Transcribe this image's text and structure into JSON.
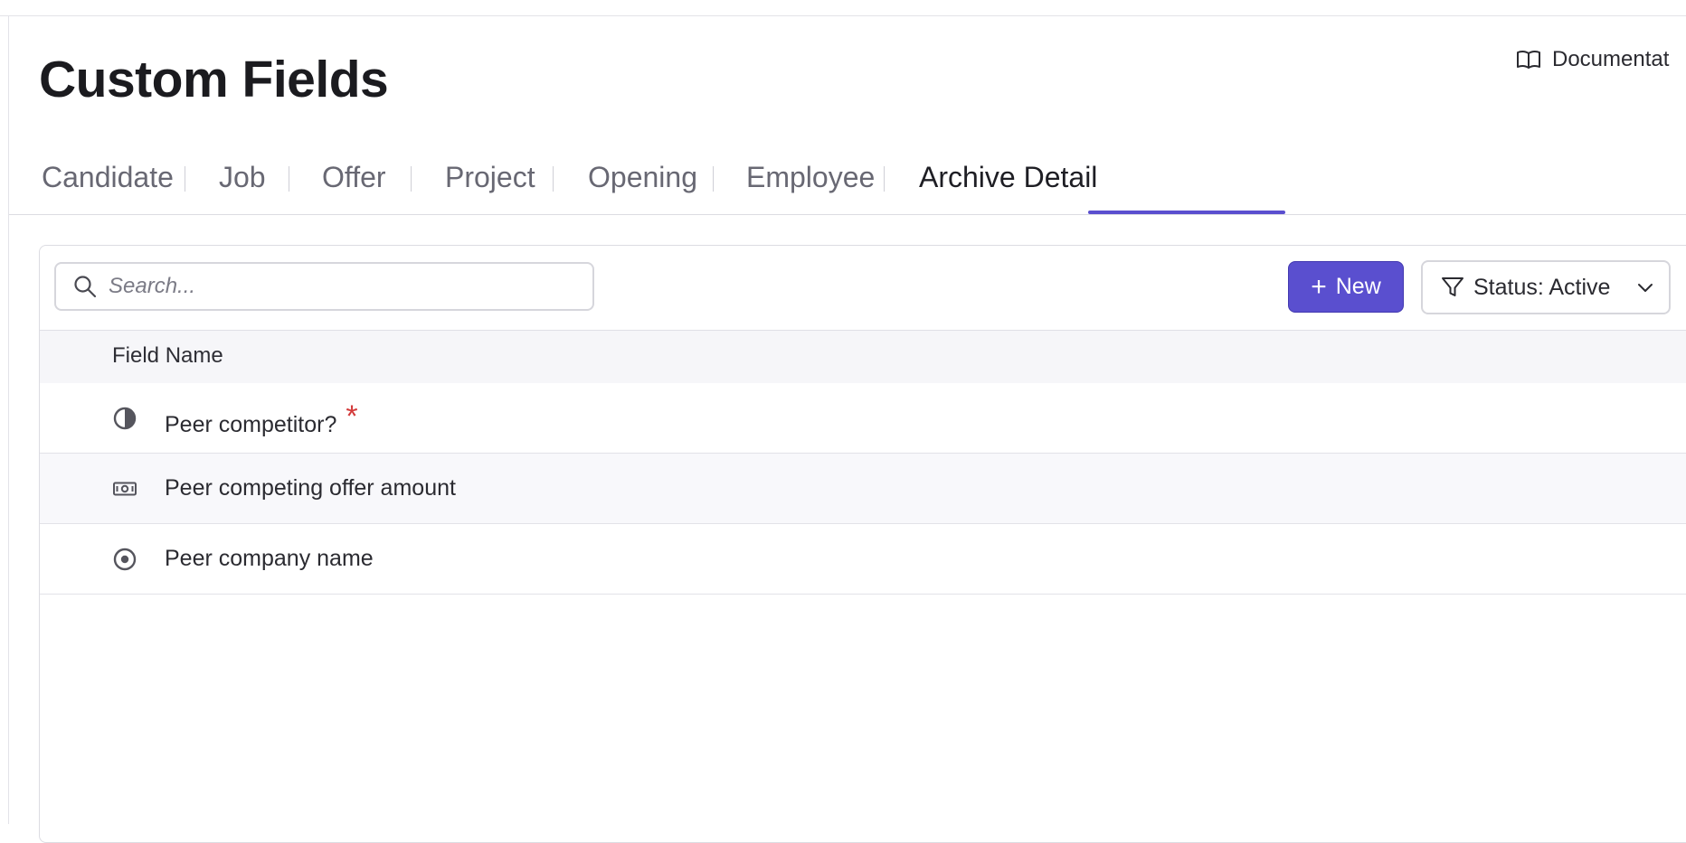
{
  "page": {
    "title": "Custom Fields",
    "documentation_label": "Documentat"
  },
  "tabs": [
    {
      "label": "Candidate",
      "active": false
    },
    {
      "label": "Job",
      "active": false
    },
    {
      "label": "Offer",
      "active": false
    },
    {
      "label": "Project",
      "active": false
    },
    {
      "label": "Opening",
      "active": false
    },
    {
      "label": "Employee",
      "active": false
    },
    {
      "label": "Archive Detail",
      "active": true
    }
  ],
  "toolbar": {
    "search_placeholder": "Search...",
    "new_label": "New",
    "status_filter_label": "Status: Active"
  },
  "table": {
    "columns": [
      "Field Name"
    ],
    "rows": [
      {
        "icon": "half-circle-icon",
        "name": "Peer competitor?",
        "required_mark": "*"
      },
      {
        "icon": "currency-note-icon",
        "name": "Peer competing offer amount",
        "required_mark": ""
      },
      {
        "icon": "radio-dot-icon",
        "name": "Peer company name",
        "required_mark": ""
      }
    ]
  },
  "colors": {
    "accent": "#5a4fcf",
    "required": "#d33a3a"
  }
}
